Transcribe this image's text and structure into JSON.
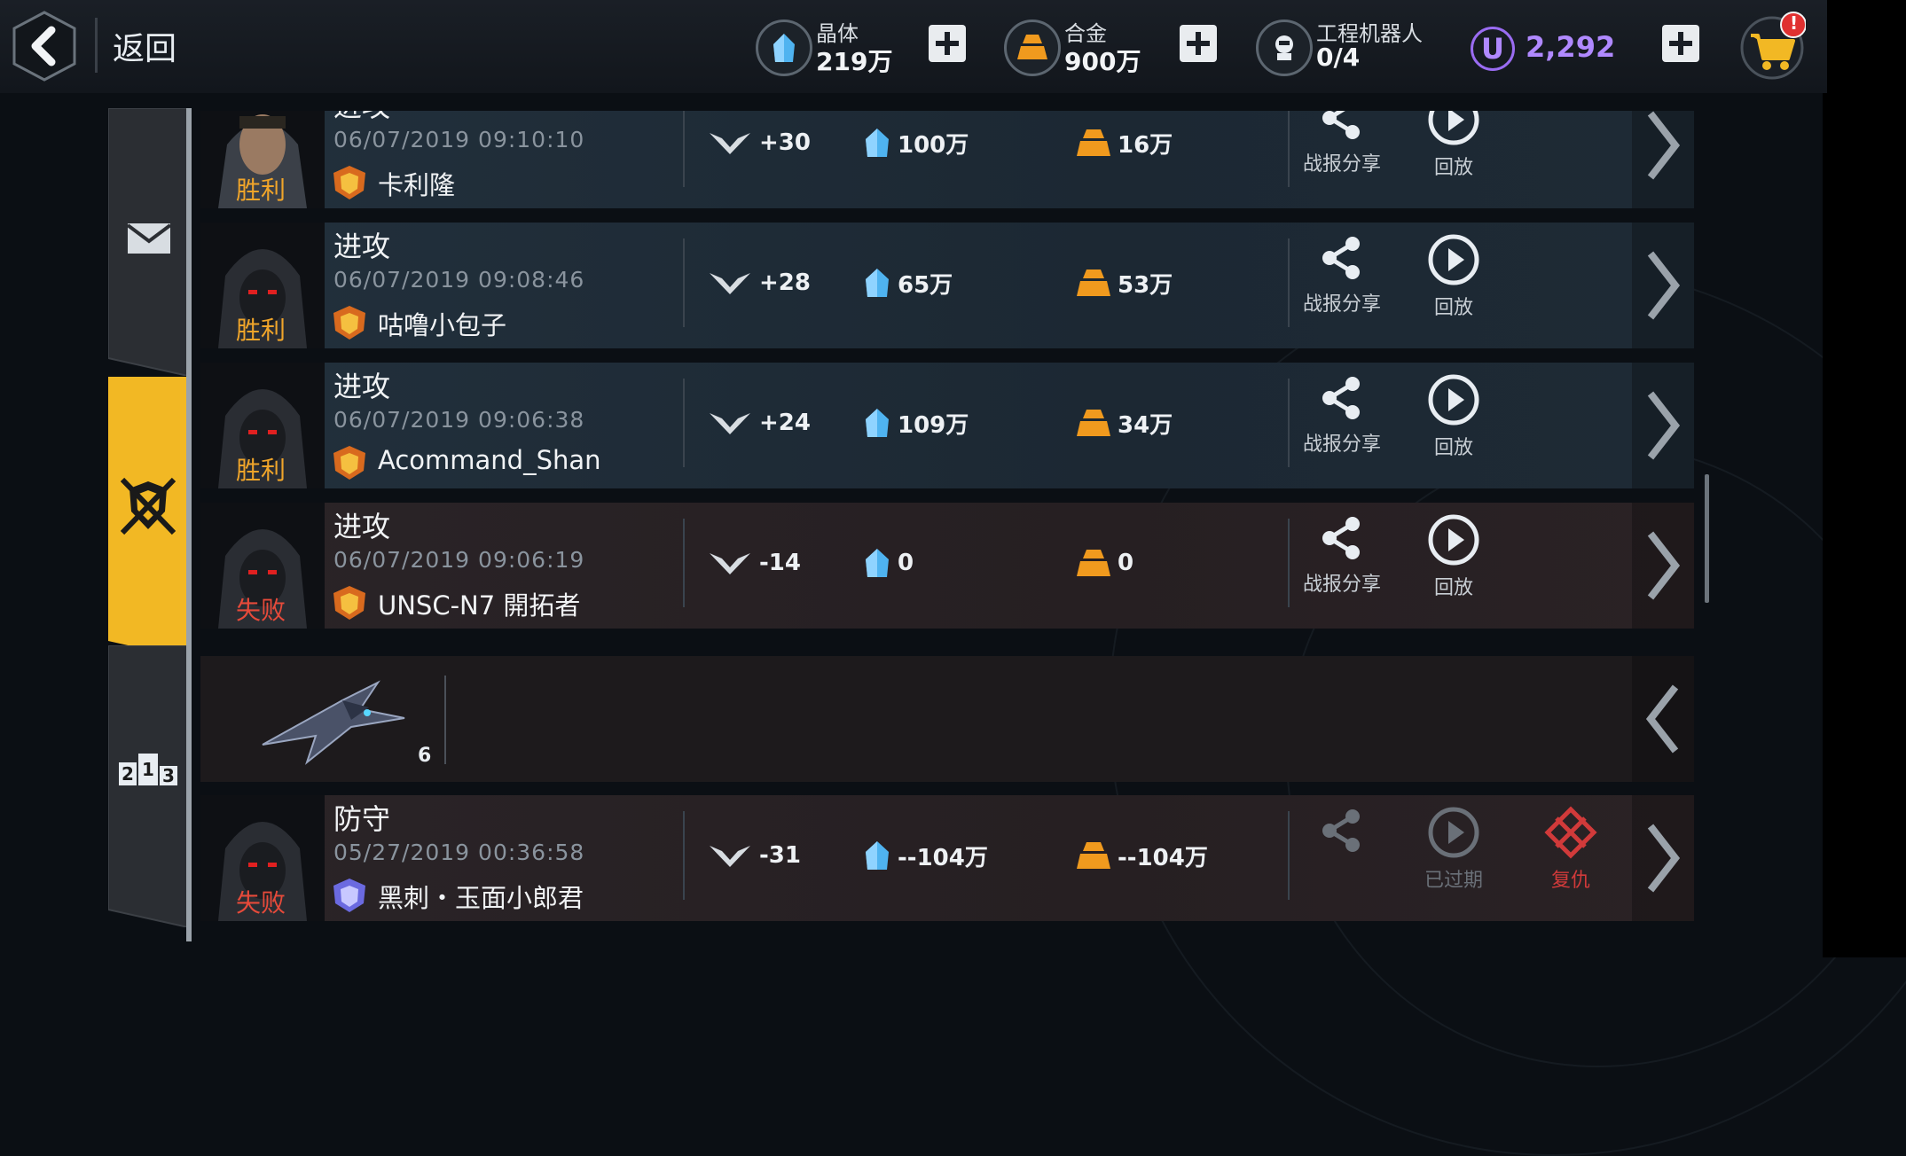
{
  "header": {
    "back_label": "返回",
    "crystal": {
      "name": "晶体",
      "value": "219万"
    },
    "alloy": {
      "name": "合金",
      "value": "900万"
    },
    "robot": {
      "name": "工程机器人",
      "value": "0/4"
    },
    "currency": {
      "icon_letter": "U",
      "value": "2,292"
    },
    "cart_badge": "!"
  },
  "sidebar": {
    "tabs": [
      {
        "name": "mail",
        "active": false
      },
      {
        "name": "battle-log",
        "active": true
      },
      {
        "name": "ranking",
        "active": false,
        "digits": [
          "2",
          "1",
          "3"
        ]
      }
    ]
  },
  "battles": [
    {
      "type": "进攻",
      "time": "06/07/2019 09:10:10",
      "player": "卡利隆",
      "result": "胜利",
      "outcome": "win",
      "trophy": "+30",
      "crystal": "100万",
      "alloy": "16万",
      "share": "战报分享",
      "replay": "回放"
    },
    {
      "type": "进攻",
      "time": "06/07/2019 09:08:46",
      "player": "咕噜小包子",
      "result": "胜利",
      "outcome": "win",
      "trophy": "+28",
      "crystal": "65万",
      "alloy": "53万",
      "share": "战报分享",
      "replay": "回放"
    },
    {
      "type": "进攻",
      "time": "06/07/2019 09:06:38",
      "player": "Acommand_Shan",
      "result": "胜利",
      "outcome": "win",
      "trophy": "+24",
      "crystal": "109万",
      "alloy": "34万",
      "share": "战报分享",
      "replay": "回放"
    },
    {
      "type": "进攻",
      "time": "06/07/2019 09:06:19",
      "player": "UNSC-N7 開拓者",
      "result": "失败",
      "outcome": "lose",
      "trophy": "-14",
      "crystal": "0",
      "alloy": "0",
      "share": "战报分享",
      "replay": "回放"
    }
  ],
  "detail_row": {
    "ship_count": "6"
  },
  "defense_battle": {
    "type": "防守",
    "time": "05/27/2019 00:36:58",
    "player": "黑刺・玉面小郎君",
    "result": "失败",
    "trophy": "-31",
    "crystal": "--104万",
    "alloy": "--104万",
    "replay": "已过期",
    "revenge": "复仇"
  },
  "colors": {
    "accent_yellow": "#f2b824",
    "win": "#f0a52a",
    "lose": "#e64a3a",
    "crystal": "#4fb3f0",
    "alloy": "#f09a1e",
    "premium": "#b089ff"
  }
}
